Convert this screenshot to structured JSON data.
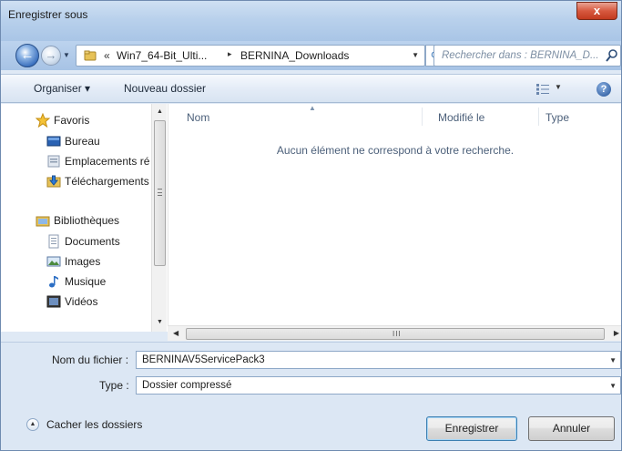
{
  "window": {
    "title": "Enregistrer sous",
    "close_label": "x"
  },
  "nav": {
    "back_label": "←",
    "forward_label": "→",
    "breadcrumb": {
      "overflow": "«",
      "items": [
        "Win7_64-Bit_Ulti...",
        "BERNINA_Downloads"
      ],
      "separator": "▸"
    },
    "search_placeholder": "Rechercher dans : BERNINA_D..."
  },
  "toolbar": {
    "organize_label": "Organiser ▾",
    "new_folder_label": "Nouveau dossier",
    "views_drop": "▼",
    "help_label": "?"
  },
  "sidebar": {
    "items": [
      {
        "label": "Favoris",
        "icon": "star-icon"
      },
      {
        "label": "Bureau",
        "icon": "desktop-icon"
      },
      {
        "label": "Emplacements ré",
        "icon": "recent-places-icon"
      },
      {
        "label": "Téléchargements",
        "icon": "downloads-icon"
      },
      {
        "label": "Bibliothèques",
        "icon": "libraries-icon"
      },
      {
        "label": "Documents",
        "icon": "documents-icon"
      },
      {
        "label": "Images",
        "icon": "images-icon"
      },
      {
        "label": "Musique",
        "icon": "music-icon"
      },
      {
        "label": "Vidéos",
        "icon": "videos-icon"
      }
    ]
  },
  "content": {
    "columns": [
      "Nom",
      "Modifié le",
      "Type"
    ],
    "empty_message": "Aucun élément ne correspond à votre recherche."
  },
  "form": {
    "filename_label": "Nom du fichier :",
    "filename_value": "BERNINAV5ServicePack3",
    "type_label": "Type :",
    "type_value": "Dossier compressé"
  },
  "footer": {
    "hide_folders_label": "Cacher les dossiers",
    "save_label": "Enregistrer",
    "cancel_label": "Annuler"
  },
  "colors": {
    "accent": "#3c7fb1",
    "frame": "#dfe9f5",
    "close": "#c23a1f"
  }
}
